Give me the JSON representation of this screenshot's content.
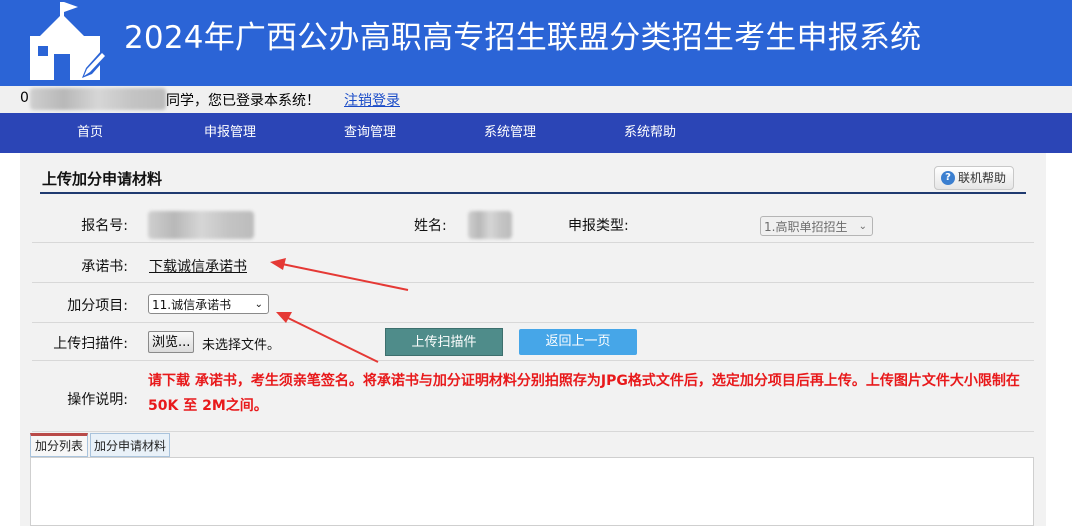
{
  "header": {
    "title": "2024年广西公办高职高专招生联盟分类招生考生申报系统"
  },
  "user_bar": {
    "id_prefix": "0",
    "greeting": "同学，您已登录本系统！",
    "logout": "注销登录"
  },
  "nav": [
    "首页",
    "申报管理",
    "查询管理",
    "系统管理",
    "系统帮助"
  ],
  "panel": {
    "title": "上传加分申请材料",
    "help_button": "联机帮助",
    "rows": {
      "reg_no_label": "报名号:",
      "name_label": "姓名:",
      "type_label": "申报类型:",
      "type_value": "1.高职单招招生",
      "pledge_label": "承诺书:",
      "pledge_link": "下载诚信承诺书",
      "bonus_label": "加分项目:",
      "bonus_value": "11.诚信承诺书",
      "upload_label": "上传扫描件:",
      "browse_button": "浏览...",
      "no_file": "未选择文件。",
      "upload_button": "上传扫描件",
      "back_button": "返回上一页",
      "instructions_label": "操作说明:",
      "instructions_text": "请下载 承诺书，考生须亲笔签名。将承诺书与加分证明材料分别拍照存为JPG格式文件后，选定加分项目后再上传。上传图片文件大小限制在 50K 至 2M之间。"
    },
    "tabs": [
      "加分列表",
      "加分申请材料"
    ]
  },
  "colors": {
    "header_bg": "#2b64d6",
    "nav_bg": "#2b45b6",
    "instruction_red": "#e8191b",
    "arrow_red": "#e53935"
  }
}
